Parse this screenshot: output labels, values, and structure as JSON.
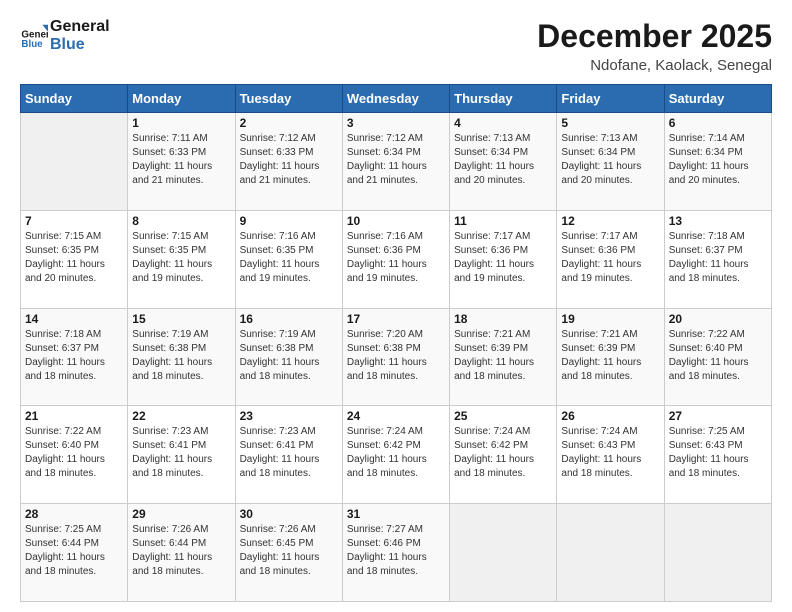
{
  "header": {
    "logo_line1": "General",
    "logo_line2": "Blue",
    "month": "December 2025",
    "location": "Ndofane, Kaolack, Senegal"
  },
  "days_of_week": [
    "Sunday",
    "Monday",
    "Tuesday",
    "Wednesday",
    "Thursday",
    "Friday",
    "Saturday"
  ],
  "weeks": [
    [
      {
        "day": "",
        "sunrise": "",
        "sunset": "",
        "daylight": ""
      },
      {
        "day": "1",
        "sunrise": "Sunrise: 7:11 AM",
        "sunset": "Sunset: 6:33 PM",
        "daylight": "Daylight: 11 hours and 21 minutes."
      },
      {
        "day": "2",
        "sunrise": "Sunrise: 7:12 AM",
        "sunset": "Sunset: 6:33 PM",
        "daylight": "Daylight: 11 hours and 21 minutes."
      },
      {
        "day": "3",
        "sunrise": "Sunrise: 7:12 AM",
        "sunset": "Sunset: 6:34 PM",
        "daylight": "Daylight: 11 hours and 21 minutes."
      },
      {
        "day": "4",
        "sunrise": "Sunrise: 7:13 AM",
        "sunset": "Sunset: 6:34 PM",
        "daylight": "Daylight: 11 hours and 20 minutes."
      },
      {
        "day": "5",
        "sunrise": "Sunrise: 7:13 AM",
        "sunset": "Sunset: 6:34 PM",
        "daylight": "Daylight: 11 hours and 20 minutes."
      },
      {
        "day": "6",
        "sunrise": "Sunrise: 7:14 AM",
        "sunset": "Sunset: 6:34 PM",
        "daylight": "Daylight: 11 hours and 20 minutes."
      }
    ],
    [
      {
        "day": "7",
        "sunrise": "Sunrise: 7:15 AM",
        "sunset": "Sunset: 6:35 PM",
        "daylight": "Daylight: 11 hours and 20 minutes."
      },
      {
        "day": "8",
        "sunrise": "Sunrise: 7:15 AM",
        "sunset": "Sunset: 6:35 PM",
        "daylight": "Daylight: 11 hours and 19 minutes."
      },
      {
        "day": "9",
        "sunrise": "Sunrise: 7:16 AM",
        "sunset": "Sunset: 6:35 PM",
        "daylight": "Daylight: 11 hours and 19 minutes."
      },
      {
        "day": "10",
        "sunrise": "Sunrise: 7:16 AM",
        "sunset": "Sunset: 6:36 PM",
        "daylight": "Daylight: 11 hours and 19 minutes."
      },
      {
        "day": "11",
        "sunrise": "Sunrise: 7:17 AM",
        "sunset": "Sunset: 6:36 PM",
        "daylight": "Daylight: 11 hours and 19 minutes."
      },
      {
        "day": "12",
        "sunrise": "Sunrise: 7:17 AM",
        "sunset": "Sunset: 6:36 PM",
        "daylight": "Daylight: 11 hours and 19 minutes."
      },
      {
        "day": "13",
        "sunrise": "Sunrise: 7:18 AM",
        "sunset": "Sunset: 6:37 PM",
        "daylight": "Daylight: 11 hours and 18 minutes."
      }
    ],
    [
      {
        "day": "14",
        "sunrise": "Sunrise: 7:18 AM",
        "sunset": "Sunset: 6:37 PM",
        "daylight": "Daylight: 11 hours and 18 minutes."
      },
      {
        "day": "15",
        "sunrise": "Sunrise: 7:19 AM",
        "sunset": "Sunset: 6:38 PM",
        "daylight": "Daylight: 11 hours and 18 minutes."
      },
      {
        "day": "16",
        "sunrise": "Sunrise: 7:19 AM",
        "sunset": "Sunset: 6:38 PM",
        "daylight": "Daylight: 11 hours and 18 minutes."
      },
      {
        "day": "17",
        "sunrise": "Sunrise: 7:20 AM",
        "sunset": "Sunset: 6:38 PM",
        "daylight": "Daylight: 11 hours and 18 minutes."
      },
      {
        "day": "18",
        "sunrise": "Sunrise: 7:21 AM",
        "sunset": "Sunset: 6:39 PM",
        "daylight": "Daylight: 11 hours and 18 minutes."
      },
      {
        "day": "19",
        "sunrise": "Sunrise: 7:21 AM",
        "sunset": "Sunset: 6:39 PM",
        "daylight": "Daylight: 11 hours and 18 minutes."
      },
      {
        "day": "20",
        "sunrise": "Sunrise: 7:22 AM",
        "sunset": "Sunset: 6:40 PM",
        "daylight": "Daylight: 11 hours and 18 minutes."
      }
    ],
    [
      {
        "day": "21",
        "sunrise": "Sunrise: 7:22 AM",
        "sunset": "Sunset: 6:40 PM",
        "daylight": "Daylight: 11 hours and 18 minutes."
      },
      {
        "day": "22",
        "sunrise": "Sunrise: 7:23 AM",
        "sunset": "Sunset: 6:41 PM",
        "daylight": "Daylight: 11 hours and 18 minutes."
      },
      {
        "day": "23",
        "sunrise": "Sunrise: 7:23 AM",
        "sunset": "Sunset: 6:41 PM",
        "daylight": "Daylight: 11 hours and 18 minutes."
      },
      {
        "day": "24",
        "sunrise": "Sunrise: 7:24 AM",
        "sunset": "Sunset: 6:42 PM",
        "daylight": "Daylight: 11 hours and 18 minutes."
      },
      {
        "day": "25",
        "sunrise": "Sunrise: 7:24 AM",
        "sunset": "Sunset: 6:42 PM",
        "daylight": "Daylight: 11 hours and 18 minutes."
      },
      {
        "day": "26",
        "sunrise": "Sunrise: 7:24 AM",
        "sunset": "Sunset: 6:43 PM",
        "daylight": "Daylight: 11 hours and 18 minutes."
      },
      {
        "day": "27",
        "sunrise": "Sunrise: 7:25 AM",
        "sunset": "Sunset: 6:43 PM",
        "daylight": "Daylight: 11 hours and 18 minutes."
      }
    ],
    [
      {
        "day": "28",
        "sunrise": "Sunrise: 7:25 AM",
        "sunset": "Sunset: 6:44 PM",
        "daylight": "Daylight: 11 hours and 18 minutes."
      },
      {
        "day": "29",
        "sunrise": "Sunrise: 7:26 AM",
        "sunset": "Sunset: 6:44 PM",
        "daylight": "Daylight: 11 hours and 18 minutes."
      },
      {
        "day": "30",
        "sunrise": "Sunrise: 7:26 AM",
        "sunset": "Sunset: 6:45 PM",
        "daylight": "Daylight: 11 hours and 18 minutes."
      },
      {
        "day": "31",
        "sunrise": "Sunrise: 7:27 AM",
        "sunset": "Sunset: 6:46 PM",
        "daylight": "Daylight: 11 hours and 18 minutes."
      },
      {
        "day": "",
        "sunrise": "",
        "sunset": "",
        "daylight": ""
      },
      {
        "day": "",
        "sunrise": "",
        "sunset": "",
        "daylight": ""
      },
      {
        "day": "",
        "sunrise": "",
        "sunset": "",
        "daylight": ""
      }
    ]
  ]
}
